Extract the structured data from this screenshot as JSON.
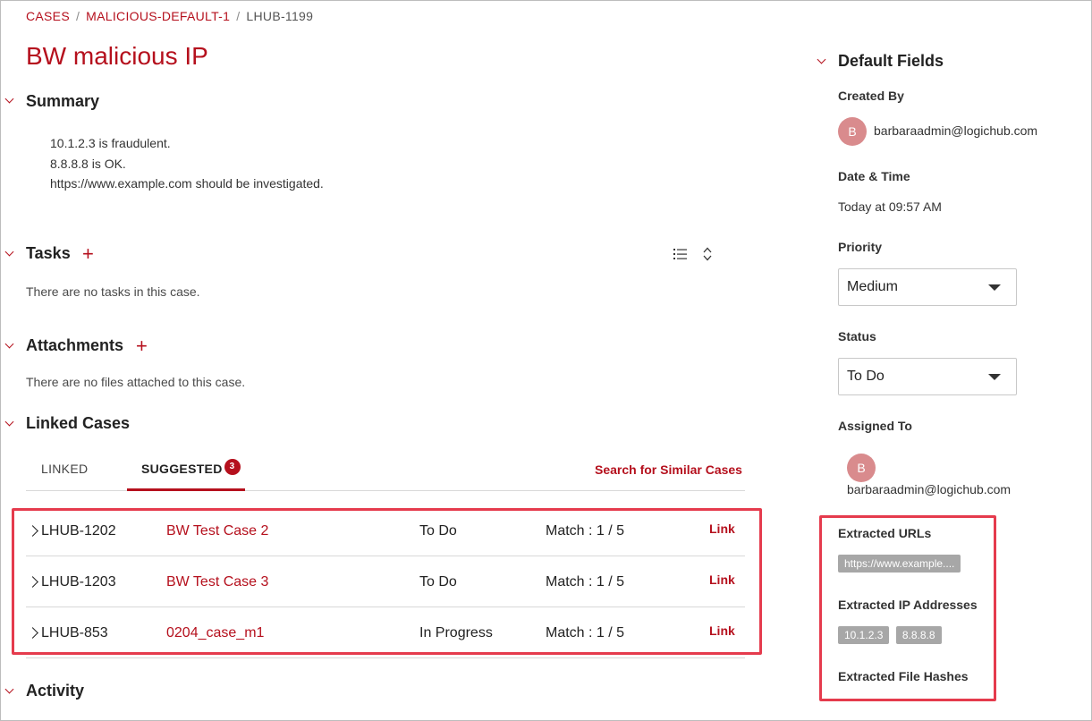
{
  "breadcrumb": {
    "items": [
      "CASES",
      "MALICIOUS-DEFAULT-1"
    ],
    "separator": "/",
    "current": "LHUB-1199"
  },
  "title": "BW malicious IP",
  "summary": {
    "heading": "Summary",
    "lines": [
      "10.1.2.3 is fraudulent.",
      "8.8.8.8 is OK.",
      "https://www.example.com should be investigated."
    ]
  },
  "tasks": {
    "heading": "Tasks",
    "add_label": "+",
    "empty_text": "There are no tasks in this case."
  },
  "attachments": {
    "heading": "Attachments",
    "add_label": "+",
    "empty_text": "There are no files attached to this case."
  },
  "linked_cases": {
    "heading": "Linked Cases",
    "tabs": [
      {
        "label": "LINKED"
      },
      {
        "label": "SUGGESTED",
        "badge": "3"
      }
    ],
    "search_label": "Search for Similar Cases",
    "rows": [
      {
        "id": "LHUB-1202",
        "name": "BW Test Case 2",
        "status": "To Do",
        "match": "Match : 1 / 5",
        "action": "Link"
      },
      {
        "id": "LHUB-1203",
        "name": "BW Test Case 3",
        "status": "To Do",
        "match": "Match : 1 / 5",
        "action": "Link"
      },
      {
        "id": "LHUB-853",
        "name": "0204_case_m1",
        "status": "In Progress",
        "match": "Match : 1 / 5",
        "action": "Link"
      }
    ]
  },
  "activity": {
    "heading": "Activity"
  },
  "default_fields": {
    "heading": "Default Fields",
    "created_by": {
      "label": "Created By",
      "avatar": "B",
      "value": "barbaraadmin@logichub.com"
    },
    "date_time": {
      "label": "Date & Time",
      "value": "Today at 09:57 AM"
    },
    "priority": {
      "label": "Priority",
      "value": "Medium"
    },
    "status": {
      "label": "Status",
      "value": "To Do"
    },
    "assigned_to": {
      "label": "Assigned To",
      "avatar": "B",
      "value": "barbaraadmin@logichub.com"
    }
  },
  "extracted": {
    "urls_label": "Extracted URLs",
    "urls": [
      "https://www.example...."
    ],
    "ips_label": "Extracted IP Addresses",
    "ips": [
      "10.1.2.3",
      "8.8.8.8"
    ],
    "hashes_label": "Extracted File Hashes"
  },
  "colors": {
    "accent": "#b5101d",
    "highlight_box": "#e53b4d",
    "avatar": "#d98b8d",
    "tag": "#a7a7a7"
  }
}
